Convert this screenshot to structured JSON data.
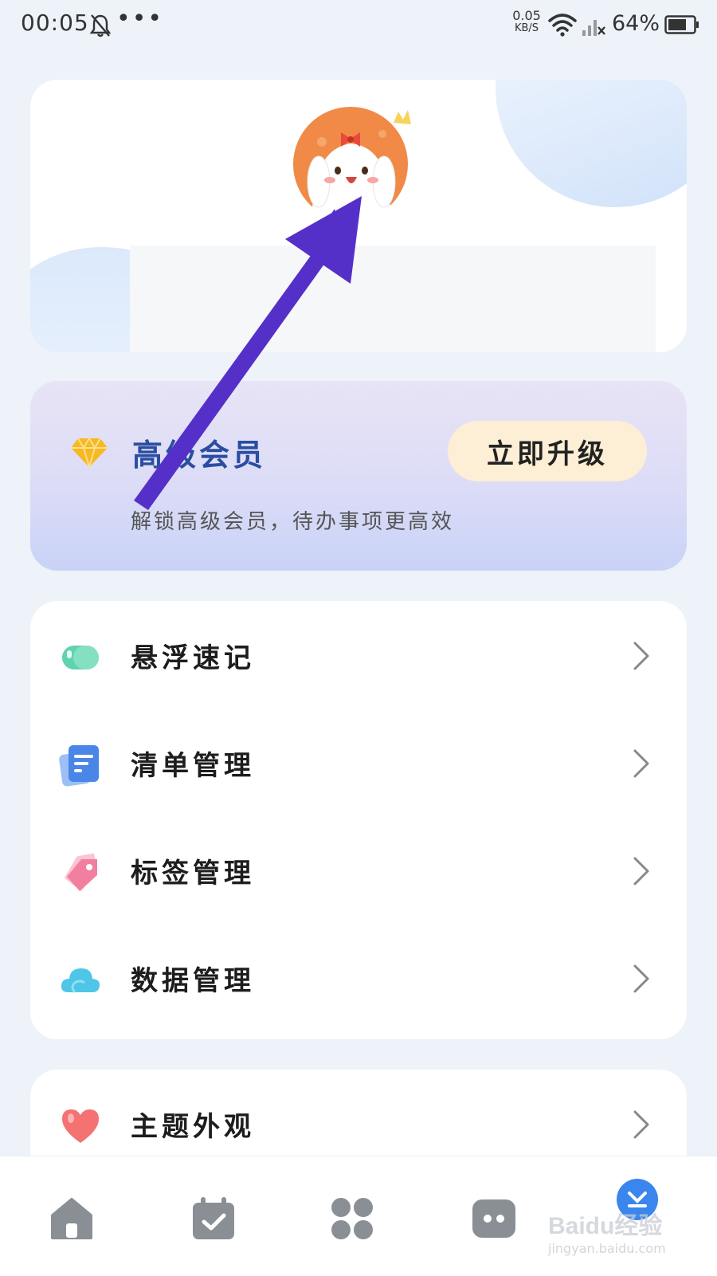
{
  "status_bar": {
    "time": "00:05",
    "dots": "•••",
    "net_speed_value": "0.05",
    "net_speed_unit": "KB/S",
    "battery": "64%"
  },
  "profile": {
    "avatar": "bunny-avatar-icon"
  },
  "premium": {
    "title": "高级会员",
    "subtitle": "解锁高级会员，待办事项更高效",
    "upgrade_label": "立即升级",
    "accent": "#2a4ea0"
  },
  "menu": {
    "items": [
      {
        "label": "悬浮速记",
        "icon": "floating-note-icon"
      },
      {
        "label": "清单管理",
        "icon": "list-icon"
      },
      {
        "label": "标签管理",
        "icon": "tag-icon"
      },
      {
        "label": "数据管理",
        "icon": "cloud-icon"
      }
    ]
  },
  "theme": {
    "label": "主题外观",
    "icon": "heart-icon"
  },
  "bottom_nav": {
    "items": [
      "home-icon",
      "calendar-check-icon",
      "apps-icon",
      "chat-icon",
      "profile-icon"
    ]
  },
  "watermark": {
    "top": "Baidu经验",
    "bottom": "jingyan.baidu.com"
  },
  "colors": {
    "background": "#eef2f9",
    "arrow": "#5530c8",
    "upgrade_button": "#fdeed6"
  }
}
